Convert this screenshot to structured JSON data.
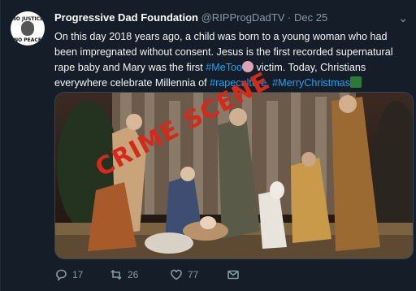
{
  "tweet": {
    "author_name": "Progressive Dad Foundation",
    "handle": "@RIPProgDadTV",
    "separator": "·",
    "date": "Dec 25",
    "avatar_text_top": "NO JUSTICE",
    "avatar_text_bottom": "NO PEACE",
    "body_part1": "On this day 2018 years ago, a child was born to a young woman who had been impregnated without consent. Jesus is the first recorded supernatural rape baby and Mary was the first ",
    "hashtag_metoo": "#MeToo",
    "body_part2": " victim. Today, Christians everywhere celebrate Millennia of ",
    "hashtag_rapeculture": "#rapeculture",
    "body_part3": ". ",
    "hashtag_merrychristmas": "#MerryChristmas",
    "image_stamp_text": "CRIME SCENE"
  },
  "actions": {
    "reply_count": "17",
    "retweet_count": "26",
    "like_count": "77"
  },
  "icons": {
    "menu": "chevron-down-icon",
    "reply": "reply-icon",
    "retweet": "retweet-icon",
    "like": "heart-icon",
    "dm": "mail-icon"
  },
  "colors": {
    "background": "#151e28",
    "link": "#1da1f2",
    "muted": "#8899a6",
    "stamp": "#d42a1c"
  }
}
